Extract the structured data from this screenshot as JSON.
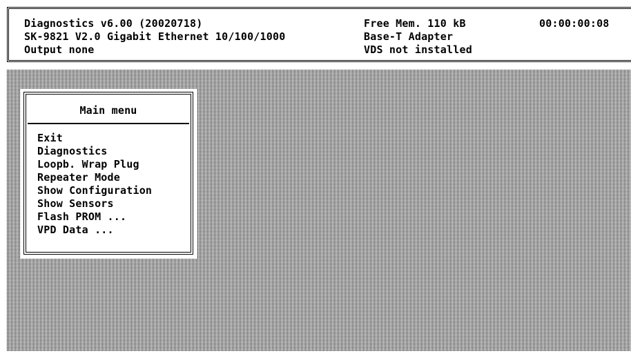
{
  "header": {
    "line1_left": "Diagnostics v6.00 (20020718)",
    "line2_left": "SK-9821 V2.0 Gigabit Ethernet 10/100/1000",
    "line3_left": "Output none",
    "line1_right": "Free Mem. 110 kB",
    "line2_right": "Base-T Adapter",
    "line3_right": "VDS not installed",
    "clock": "00:00:00:08"
  },
  "menu": {
    "title": "Main menu",
    "items": [
      {
        "label": "Exit"
      },
      {
        "label": "Diagnostics"
      },
      {
        "label": "Loopb. Wrap Plug"
      },
      {
        "label": "Repeater Mode"
      },
      {
        "label": "Show Configuration"
      },
      {
        "label": "Show Sensors"
      },
      {
        "label": "Flash PROM ..."
      },
      {
        "label": "VPD Data ..."
      }
    ]
  }
}
